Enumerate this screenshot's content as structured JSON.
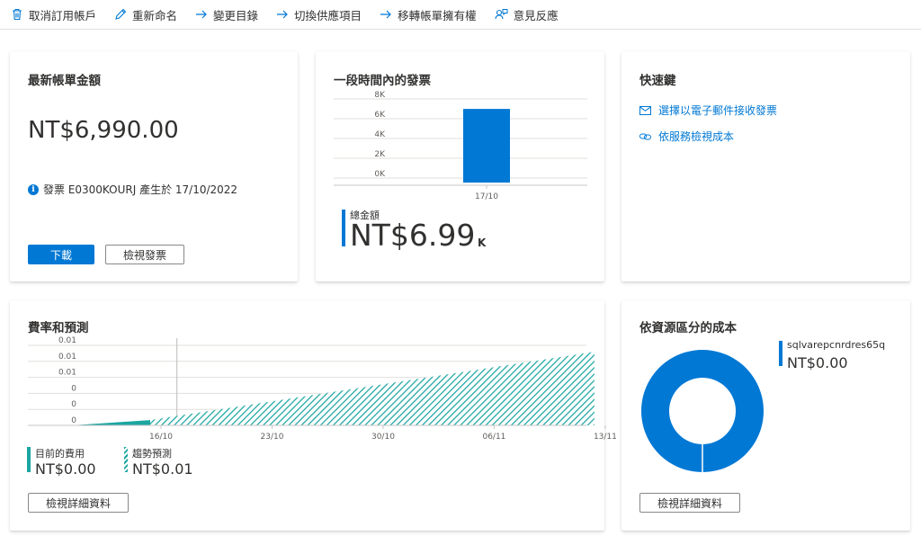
{
  "toolbar": {
    "items": [
      {
        "label": "取消訂用帳戶",
        "icon": "trash-icon"
      },
      {
        "label": "重新命名",
        "icon": "pencil-icon"
      },
      {
        "label": "變更目錄",
        "icon": "arrow-right-icon"
      },
      {
        "label": "切換供應項目",
        "icon": "arrow-right-icon"
      },
      {
        "label": "移轉帳單擁有權",
        "icon": "arrow-right-icon"
      },
      {
        "label": "意見反應",
        "icon": "feedback-icon"
      }
    ]
  },
  "latest_bill": {
    "title": "最新帳單金額",
    "amount": "NT$6,990.00",
    "info": "發票 E0300KOURJ 產生於 17/10/2022",
    "download_label": "下載",
    "view_invoice_label": "檢視發票"
  },
  "invoices_period": {
    "title": "一段時間內的發票",
    "total_label": "總金額",
    "total_value": "NT$6.99",
    "total_unit": "K"
  },
  "shortcuts": {
    "title": "快速鍵",
    "links": [
      {
        "label": "選擇以電子郵件接收發票",
        "icon": "mail-icon"
      },
      {
        "label": "依服務檢視成本",
        "icon": "link-icon"
      }
    ]
  },
  "rate_forecast": {
    "title": "費率和預測",
    "current_label": "目前的費用",
    "current_value": "NT$0.00",
    "forecast_label": "趨勢預測",
    "forecast_value": "NT$0.01",
    "details_label": "檢視詳細資料"
  },
  "cost_by_resource": {
    "title": "依資源區分的成本",
    "resource_name": "sqlvarepcnrdres65q",
    "resource_value": "NT$0.00",
    "details_label": "檢視詳細資料"
  },
  "colors": {
    "accent": "#0078d4",
    "teal": "#1ba6a1"
  },
  "chart_data": [
    {
      "type": "bar",
      "categories": [
        "17/10"
      ],
      "values": [
        6990
      ],
      "y_ticks": [
        "0K",
        "2K",
        "4K",
        "6K",
        "8K"
      ],
      "ylim": [
        0,
        8000
      ],
      "grid": true
    },
    {
      "type": "area",
      "x_ticks": [
        "16/10",
        "23/10",
        "30/10",
        "06/11",
        "13/11"
      ],
      "y_ticks": [
        "0",
        "0",
        "0",
        "0.01",
        "0.01",
        "0.01"
      ],
      "series": [
        {
          "name": "目前的費用",
          "style": "solid",
          "x": [
            "11/10",
            "16/10"
          ],
          "y": [
            0,
            0.001
          ]
        },
        {
          "name": "趨勢預測",
          "style": "hatched",
          "x": [
            "16/10",
            "13/11"
          ],
          "y": [
            0.001,
            0.0138
          ]
        }
      ],
      "ylim": [
        0,
        0.015
      ],
      "today": "17/10",
      "grid": true
    },
    {
      "type": "pie",
      "variant": "donut",
      "labels": [
        "sqlvarepcnrdres65q"
      ],
      "values": [
        100
      ]
    }
  ]
}
